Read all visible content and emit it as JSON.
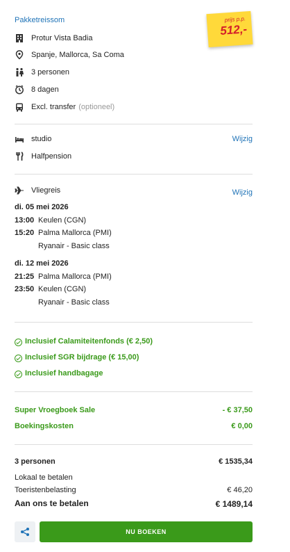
{
  "header": {
    "title": "Pakketreissom"
  },
  "price_tag": {
    "label": "prijs p.p.",
    "amount": "512,-"
  },
  "trip": {
    "hotel": "Protur Vista Badia",
    "location": "Spanje, Mallorca, Sa Coma",
    "persons": "3 personen",
    "duration": "8 dagen",
    "transfer": "Excl. transfer",
    "transfer_optional": "(optioneel)"
  },
  "accommodation": {
    "room": "studio",
    "board": "Halfpension",
    "change_label": "Wijzig"
  },
  "flight": {
    "label": "Vliegreis",
    "change_label": "Wijzig",
    "outbound": {
      "date": "di. 05 mei 2026",
      "dep_time": "13:00",
      "dep_airport": "Keulen (CGN)",
      "arr_time": "15:20",
      "arr_airport": "Palma Mallorca (PMI)",
      "carrier": "Ryanair - Basic class"
    },
    "return": {
      "date": "di. 12 mei 2026",
      "dep_time": "21:25",
      "dep_airport": "Palma Mallorca (PMI)",
      "arr_time": "23:50",
      "arr_airport": "Keulen (CGN)",
      "carrier": "Ryanair - Basic class"
    }
  },
  "inclusions": [
    "Inclusief Calamiteitenfonds (€ 2,50)",
    "Inclusief SGR bijdrage (€ 15,00)",
    "Inclusief handbagage"
  ],
  "discounts": [
    {
      "label": "Super Vroegboek Sale",
      "value": "- € 37,50"
    },
    {
      "label": "Boekingskosten",
      "value": "€ 0,00"
    }
  ],
  "totals": {
    "persons_label": "3 personen",
    "persons_value": "€ 1535,34",
    "local_label": "Lokaal te betalen",
    "tax_label": "Toeristenbelasting",
    "tax_value": "€ 46,20",
    "pay_label": "Aan ons te betalen",
    "pay_value": "€ 1489,14"
  },
  "actions": {
    "book_label": "NU BOEKEN"
  },
  "colors": {
    "accent": "#1f73b7",
    "green": "#3a9a1a",
    "tag": "#ffd93a",
    "tag_text": "#d4202a"
  }
}
